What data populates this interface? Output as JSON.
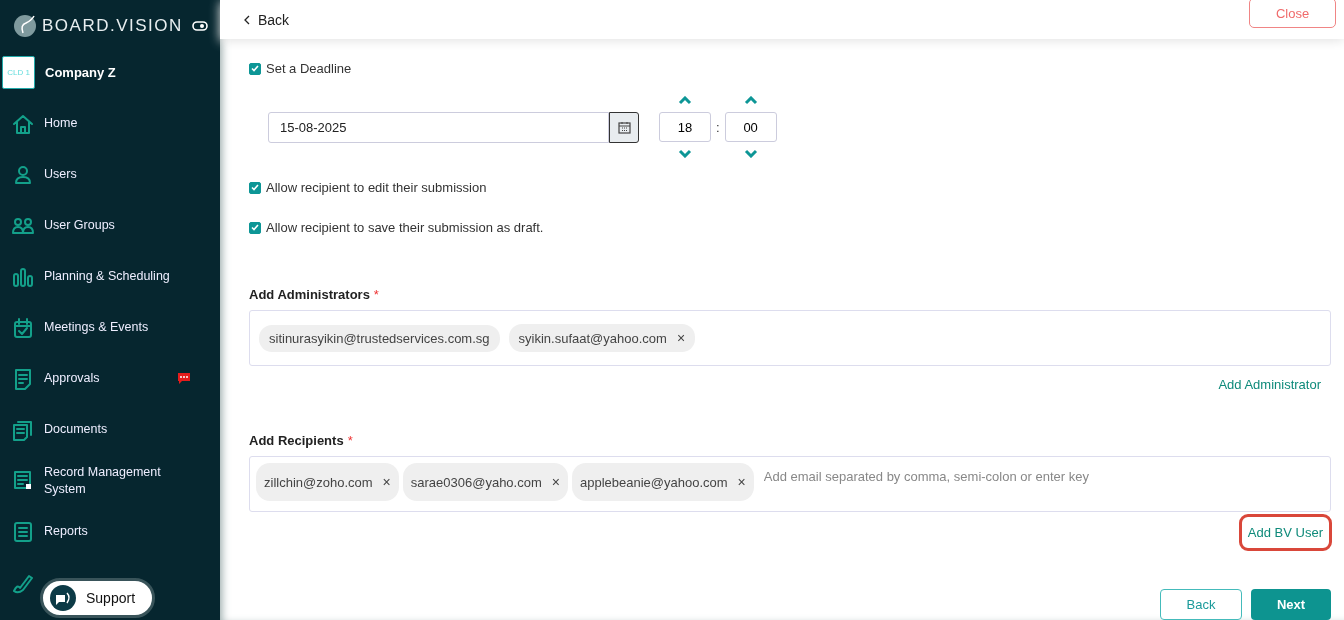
{
  "brand": {
    "name": "BOARD.VISION"
  },
  "company": {
    "logo_text": "CLD 1",
    "name": "Company Z"
  },
  "sidebar": {
    "items": [
      {
        "label": "Home",
        "badge": false
      },
      {
        "label": "Users",
        "badge": false
      },
      {
        "label": "User Groups",
        "badge": false
      },
      {
        "label": "Planning & Scheduling",
        "badge": false
      },
      {
        "label": "Meetings & Events",
        "badge": false
      },
      {
        "label": "Approvals",
        "badge": true
      },
      {
        "label": "Documents",
        "badge": false
      },
      {
        "label": "Record Management System",
        "badge": false
      },
      {
        "label": "Reports",
        "badge": false
      }
    ]
  },
  "support": {
    "label": "Support"
  },
  "header": {
    "back": "Back",
    "close": "Close"
  },
  "deadline": {
    "label": "Set a Deadline",
    "checked": true,
    "date": "15-08-2025",
    "hour": "18",
    "minute": "00",
    "separator": ":"
  },
  "options": [
    {
      "label": "Allow recipient to edit their submission",
      "checked": true
    },
    {
      "label": "Allow recipient to save their submission as draft.",
      "checked": true
    }
  ],
  "administrators": {
    "label": "Add Administrators",
    "required_mark": "*",
    "chips": [
      {
        "email": "sitinurasyikin@trustedservices.com.sg"
      },
      {
        "email": "syikin.sufaat@yahoo.com",
        "remove": "×"
      }
    ],
    "link": {
      "label": "Add Administrator",
      "highlighted": false
    }
  },
  "recipients": {
    "label": "Add Recipients",
    "required_mark": "*",
    "chips": [
      {
        "email": "zillchin@zoho.com",
        "remove": "×"
      },
      {
        "email": "sarae0306@yaho.com",
        "remove": "×"
      },
      {
        "email": "applebeanie@yahoo.com",
        "remove": "×"
      }
    ],
    "placeholder": "Add email separated by comma, semi-colon or enter key",
    "link": {
      "label": "Add BV User",
      "highlighted": true
    }
  },
  "footer": {
    "back": "Back",
    "next": "Next"
  }
}
